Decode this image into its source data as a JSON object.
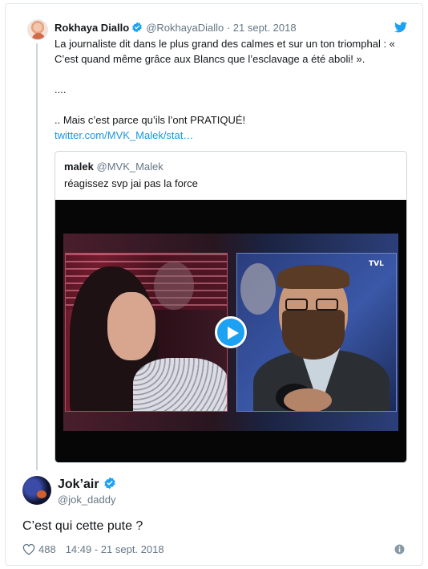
{
  "parent_tweet": {
    "name": "Rokhaya Diallo",
    "handle": "@RokhayaDiallo",
    "separator": " · ",
    "date": "21 sept. 2018",
    "lines": [
      "La journaliste dit dans le plus grand des calmes et sur un ton triomphal : « C’est quand même grâce aux Blancs que l’esclavage a été aboli! ».",
      "....",
      ".. Mais c’est parce qu’ils l’ont PRATIQUÉ!"
    ],
    "link": "twitter.com/MVK_Malek/stat…"
  },
  "quoted_tweet": {
    "name": "malek",
    "handle": "@MVK_Malek",
    "text": "réagissez svp jai pas la force",
    "video_logo": "TVL"
  },
  "main_tweet": {
    "name": "Jok’air",
    "handle": "@jok_daddy",
    "text": "C’est qui cette pute ?",
    "likes": "488",
    "timestamp": "14:49 - 21 sept. 2018"
  },
  "colors": {
    "verified_blue": "#1da1f2",
    "link_blue": "#1b95e0",
    "muted_gray": "#657786",
    "border": "#e1e8ed"
  },
  "icons": [
    "verified-badge-icon",
    "twitter-bird-icon",
    "play-icon",
    "heart-icon",
    "info-icon"
  ]
}
